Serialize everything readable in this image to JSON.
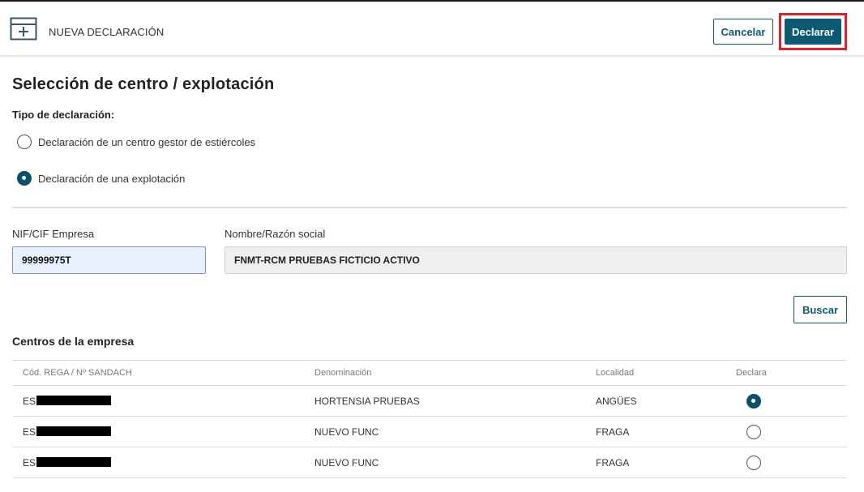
{
  "header": {
    "title": "NUEVA DECLARACIÓN",
    "icon": "new-document-icon",
    "cancel_label": "Cancelar",
    "declare_label": "Declarar",
    "accent_color": "#0b5a74",
    "highlight_color": "#e2202a"
  },
  "page": {
    "title": "Selección de centro / explotación",
    "type_label": "Tipo de declaración:",
    "options": [
      {
        "label": "Declaración de un centro gestor de estiércoles",
        "selected": false
      },
      {
        "label": "Declaración de una explotación",
        "selected": true
      }
    ]
  },
  "form": {
    "nif_label": "NIF/CIF Empresa",
    "nif_value": "99999975T",
    "name_label": "Nombre/Razón social",
    "name_value": "FNMT-RCM PRUEBAS FICTICIO ACTIVO",
    "search_label": "Buscar"
  },
  "centros": {
    "title": "Centros de la empresa",
    "columns": [
      "Cód. REGA / Nº SANDACH",
      "Denominación",
      "Localidad",
      "Declara"
    ],
    "rows": [
      {
        "code_prefix": "ES",
        "denominacion": "HORTENSIA PRUEBAS",
        "localidad": "ANGÜES",
        "declara": true
      },
      {
        "code_prefix": "ES",
        "denominacion": "NUEVO FUNC",
        "localidad": "FRAGA",
        "declara": false
      },
      {
        "code_prefix": "ES",
        "denominacion": "NUEVO FUNC",
        "localidad": "FRAGA",
        "declara": false
      }
    ]
  }
}
